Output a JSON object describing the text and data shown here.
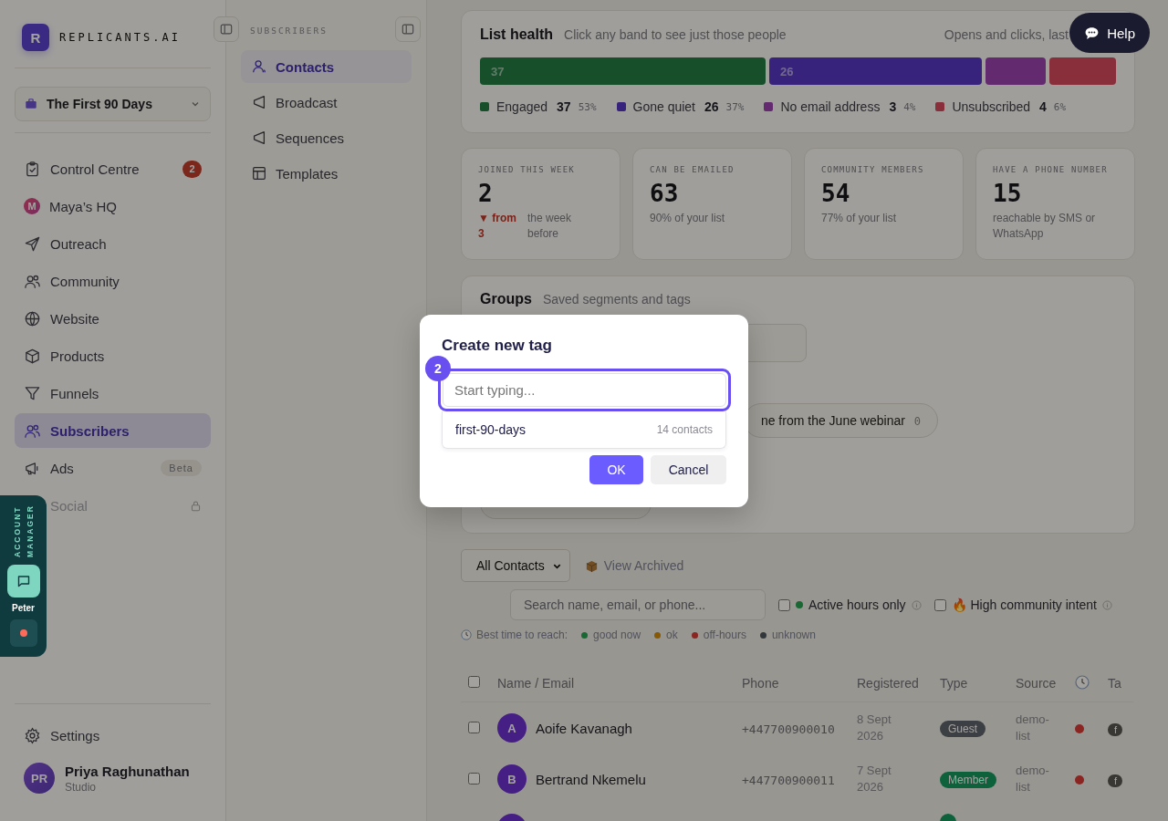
{
  "brand": {
    "logo_letter": "R",
    "name": "REPLICANTS.AI"
  },
  "workspace": {
    "name": "The First 90 Days"
  },
  "nav": [
    {
      "label": "Control Centre",
      "selected": false,
      "disabled": false,
      "badge": "2"
    },
    {
      "label": "Maya’s HQ",
      "selected": false,
      "disabled": false,
      "avatar_letter": "M"
    },
    {
      "label": "Outreach",
      "selected": false,
      "disabled": false
    },
    {
      "label": "Community",
      "selected": false,
      "disabled": false
    },
    {
      "label": "Website",
      "selected": false,
      "disabled": false
    },
    {
      "label": "Products",
      "selected": false,
      "disabled": false
    },
    {
      "label": "Funnels",
      "selected": false,
      "disabled": false
    },
    {
      "label": "Subscribers",
      "selected": true,
      "disabled": false
    },
    {
      "label": "Ads",
      "selected": false,
      "disabled": false,
      "tag": "Beta"
    },
    {
      "label": "Social",
      "selected": false,
      "disabled": true
    }
  ],
  "account_manager": {
    "title": "ACCOUNT MANAGER",
    "name": "Peter"
  },
  "footer": {
    "settings": "Settings",
    "user": {
      "initials": "PR",
      "name": "Priya Raghunathan",
      "plan": "Studio"
    }
  },
  "subnav": {
    "heading": "SUBSCRIBERS",
    "items": [
      {
        "label": "Contacts",
        "selected": true
      },
      {
        "label": "Broadcast",
        "selected": false
      },
      {
        "label": "Sequences",
        "selected": false
      },
      {
        "label": "Templates",
        "selected": false
      }
    ]
  },
  "help": {
    "label": "Help"
  },
  "list_health": {
    "title": "List health",
    "subtitle": "Click any band to see just those people",
    "period": "Opens and clicks, last",
    "bands": [
      {
        "label": "Engaged",
        "count": "37",
        "percent": "53%",
        "bar_label": "37",
        "color": "#164f2b"
      },
      {
        "label": "Gone quiet",
        "count": "26",
        "percent": "37%",
        "bar_label": "26",
        "color": "#38247c"
      },
      {
        "label": "No email address",
        "count": "3",
        "percent": "4%",
        "color": "#632a70"
      },
      {
        "label": "Unsubscribed",
        "count": "4",
        "percent": "6%",
        "color": "#892f3b"
      }
    ]
  },
  "stats": [
    {
      "label": "JOINED THIS WEEK",
      "value": "2",
      "change": "▼ from 3",
      "note": "the week before"
    },
    {
      "label": "CAN BE EMAILED",
      "value": "63",
      "note": "90% of your list"
    },
    {
      "label": "COMMUNITY MEMBERS",
      "value": "54",
      "note": "77% of your list"
    },
    {
      "label": "HAVE A PHONE NUMBER",
      "value": "15",
      "note": "reachable by SMS or WhatsApp"
    }
  ],
  "groups": {
    "title": "Groups",
    "subtitle": "Saved segments and tags",
    "chips": [
      {
        "label": "ne from the June webinar",
        "count": "0"
      }
    ]
  },
  "toolbar": {
    "view": "All Contacts",
    "archived": "View Archived",
    "search_placeholder": "Search name, email, or phone...",
    "filters": [
      {
        "label": "Active hours only",
        "checked": false,
        "kind": "dot"
      },
      {
        "label": "🔥 High community intent",
        "checked": false,
        "kind": "plain"
      }
    ],
    "legend_title": "Best time to reach:",
    "legend": [
      {
        "label": "good now",
        "color": "#196835"
      },
      {
        "label": "ok",
        "color": "#855906"
      },
      {
        "label": "off-hours",
        "color": "#8a2623"
      },
      {
        "label": "unknown",
        "color": "#32383d"
      }
    ]
  },
  "table": {
    "all_checked": false,
    "columns": [
      "Name / Email",
      "Phone",
      "Registered",
      "Type",
      "Source",
      "Ta"
    ],
    "rows": [
      {
        "checked": false,
        "initial": "A",
        "name": "Aoife Kavanagh",
        "phone": "+447700900010",
        "registered": "8 Sept 2026",
        "type": {
          "label": "Guest",
          "color": "#3c3f45"
        },
        "source": "demo-list",
        "reach": {
          "color": "#8a2623"
        },
        "tag": "f"
      },
      {
        "checked": false,
        "initial": "B",
        "name": "Bertrand Nkemelu",
        "phone": "+447700900011",
        "registered": "7 Sept 2026",
        "type": {
          "label": "Member",
          "color": "#0e623d"
        },
        "source": "demo-list",
        "reach": {
          "color": "#8a2623"
        },
        "tag": "f"
      },
      {
        "type": {
          "color": "#0e623d"
        }
      }
    ]
  },
  "modal": {
    "title": "Create new tag",
    "step": "2",
    "placeholder": "Start typing...",
    "suggestion": {
      "label": "first-90-days",
      "count": "14 contacts"
    },
    "ok": "OK",
    "cancel": "Cancel"
  }
}
